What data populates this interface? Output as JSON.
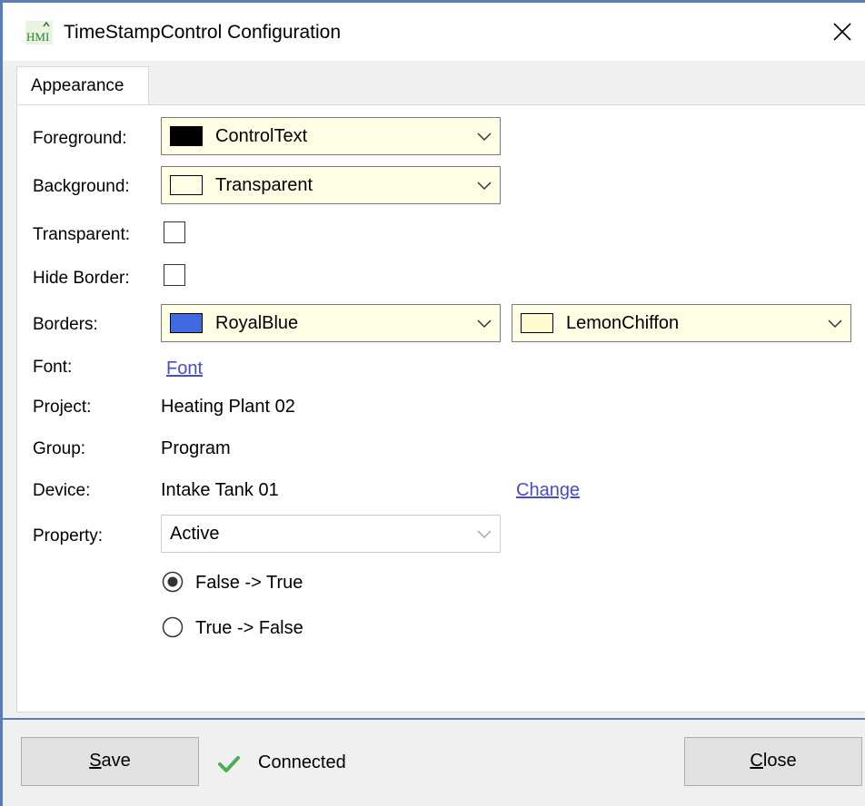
{
  "window": {
    "title": "TimeStampControl Configuration",
    "accent_color": "#5a7db8"
  },
  "icons": {
    "app": "hmi-app-icon",
    "close": "close-icon",
    "dropdown": "chevron-down-icon",
    "status": "checkmark-icon"
  },
  "tabs": [
    {
      "label": "Appearance",
      "selected": true
    }
  ],
  "form": {
    "foreground": {
      "label": "Foreground:",
      "value": "ControlText",
      "swatch_color": "#000000"
    },
    "background": {
      "label": "Background:",
      "value": "Transparent",
      "swatch_color": "#ffffe5"
    },
    "transparent": {
      "label": "Transparent:",
      "checked": false
    },
    "hide_border": {
      "label": "Hide Border:",
      "checked": false
    },
    "borders": {
      "label": "Borders:",
      "primary": {
        "value": "RoyalBlue",
        "swatch_color": "#4169e1"
      },
      "secondary": {
        "value": "LemonChiffon",
        "swatch_color": "#fffacd"
      }
    },
    "font": {
      "label": "Font:",
      "link": "Font"
    },
    "project": {
      "label": "Project:",
      "value": "Heating Plant 02"
    },
    "group": {
      "label": "Group:",
      "value": "Program"
    },
    "device": {
      "label": "Device:",
      "value": "Intake Tank 01",
      "change_link": "Change"
    },
    "property": {
      "label": "Property:",
      "value": "Active"
    },
    "transition": {
      "options": [
        {
          "label": "False -> True",
          "selected": true
        },
        {
          "label": "True -> False",
          "selected": false
        }
      ]
    }
  },
  "footer": {
    "save_label": "Save",
    "save_mnemonic": "S",
    "save_rest": "ave",
    "close_label": "Close",
    "close_mnemonic": "C",
    "close_rest": "lose",
    "status": "Connected",
    "status_color": "#4caf50"
  }
}
